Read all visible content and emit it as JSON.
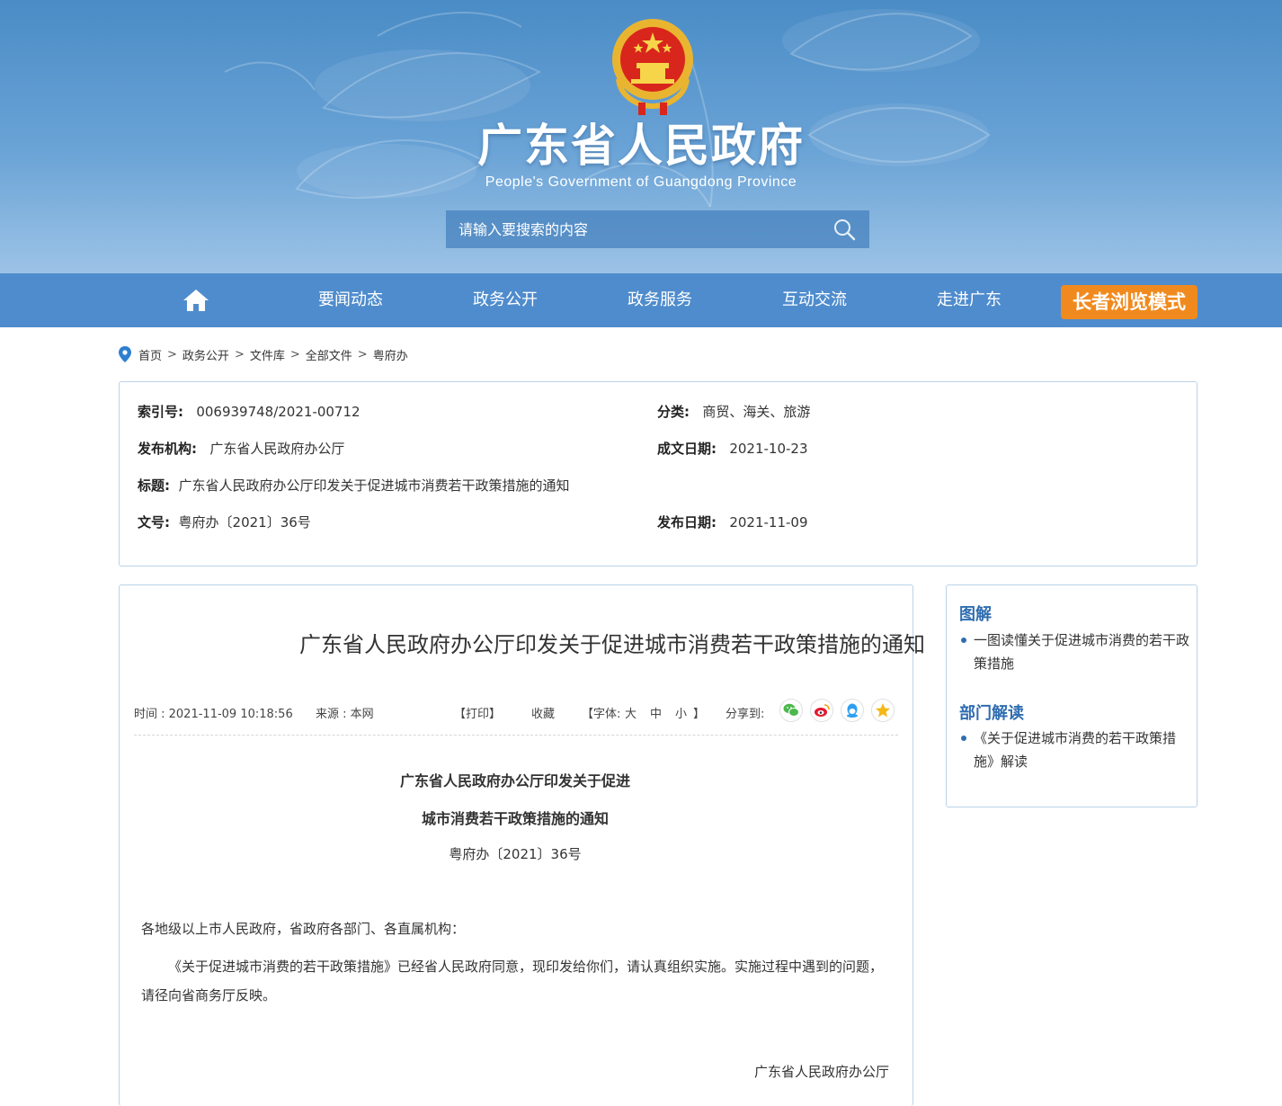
{
  "header": {
    "title": "广东省人民政府",
    "subtitle": "People's Government of Guangdong Province",
    "search_placeholder": "请输入要搜索的内容",
    "emblem_icon": "national-emblem-icon"
  },
  "nav": {
    "home_icon": "home-icon",
    "items": [
      "要闻动态",
      "政务公开",
      "政务服务",
      "互动交流",
      "走进广东"
    ],
    "elder_mode": "长者浏览模式",
    "elder_color": "#f18a1e",
    "bar_color": "#4f8ccd"
  },
  "breadcrumb": {
    "items": [
      "首页",
      "政务公开",
      "文件库",
      "全部文件",
      "粤府办"
    ],
    "separator": ">"
  },
  "meta": {
    "index_label": "索引号:",
    "index_value": "006939748/2021-00712",
    "category_label": "分类:",
    "category_value": "商贸、海关、旅游",
    "publisher_label": "发布机构:",
    "publisher_value": "广东省人民政府办公厅",
    "written_date_label": "成文日期:",
    "written_date_value": "2021-10-23",
    "title_label": "标题:",
    "title_value": "广东省人民政府办公厅印发关于促进城市消费若干政策措施的通知",
    "doc_no_label": "文号:",
    "doc_no_value": "粤府办〔2021〕36号",
    "publish_date_label": "发布日期:",
    "publish_date_value": "2021-11-09"
  },
  "article": {
    "title": "广东省人民政府办公厅印发关于促进城市消费若干政策措施的通知",
    "time": "时间 : 2021-11-09 10:18:56",
    "source": "来源 : 本网",
    "print": "【打印】",
    "favorite": "收藏",
    "font_label": "【字体:",
    "font_large": "大",
    "font_medium": "中",
    "font_small": "小",
    "font_close": "】",
    "share_label": "分享到:",
    "share_icons": [
      "wechat-icon",
      "weibo-icon",
      "qq-icon",
      "qzone-icon"
    ],
    "doc_heading_1": "广东省人民政府办公厅印发关于促进",
    "doc_heading_2": "城市消费若干政策措施的通知",
    "doc_number": "粤府办〔2021〕36号",
    "salutation": "各地级以上市人民政府，省政府各部门、各直属机构：",
    "body": "《关于促进城市消费的若干政策措施》已经省人民政府同意，现印发给你们，请认真组织实施。实施过程中遇到的问题，请径向省商务厅反映。",
    "signature": "广东省人民政府办公厅"
  },
  "sidebar": {
    "section1_title": "图解",
    "section1_item": "一图读懂关于促进城市消费的若干政策措施",
    "section2_title": "部门解读",
    "section2_item": "《关于促进城市消费的若干政策措施》解读"
  }
}
